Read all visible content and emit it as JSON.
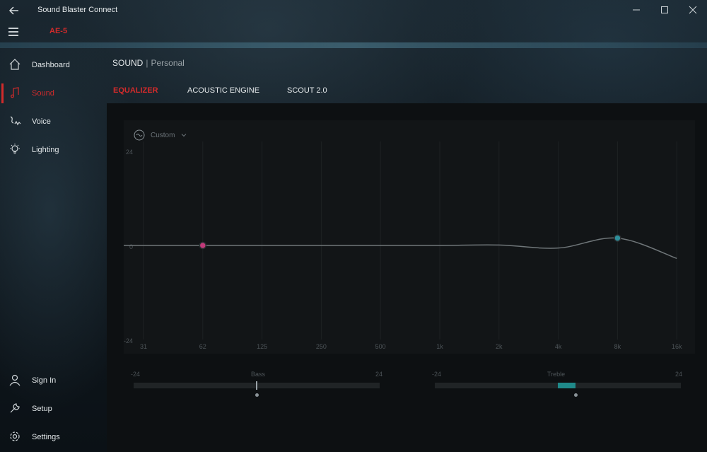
{
  "app": {
    "title": "Sound Blaster Connect",
    "device": "AE-5"
  },
  "nav": {
    "items": [
      {
        "label": "Dashboard",
        "icon": "home-icon"
      },
      {
        "label": "Sound",
        "icon": "music-note-icon",
        "active": true
      },
      {
        "label": "Voice",
        "icon": "voice-icon"
      },
      {
        "label": "Lighting",
        "icon": "lightbulb-icon"
      }
    ],
    "bottom": [
      {
        "label": "Sign In",
        "icon": "user-icon"
      },
      {
        "label": "Setup",
        "icon": "wrench-icon"
      },
      {
        "label": "Settings",
        "icon": "gear-icon"
      }
    ]
  },
  "breadcrumb": {
    "section": "SOUND",
    "separator": "|",
    "profile": "Personal"
  },
  "tabs": [
    {
      "label": "EQUALIZER",
      "active": true
    },
    {
      "label": "ACOUSTIC ENGINE"
    },
    {
      "label": "SCOUT 2.0"
    }
  ],
  "equalizer": {
    "preset": "Custom",
    "y_max_label": "24",
    "y_zero_label": "0",
    "y_min_label": "-24",
    "bands": [
      "31",
      "62",
      "125",
      "250",
      "500",
      "1k",
      "2k",
      "4k",
      "8k",
      "16k"
    ],
    "gains_db": [
      0,
      0,
      0,
      0,
      0,
      0,
      0.1,
      -0.6,
      1.7,
      -3.0
    ],
    "highlight_points": [
      {
        "band": "62",
        "gain_db": 0,
        "color": "#c13a7a"
      },
      {
        "band": "8k",
        "gain_db": 1.7,
        "color": "#2e8f9a"
      }
    ]
  },
  "bass": {
    "name": "Bass",
    "min": "-24",
    "max": "24",
    "value": 0
  },
  "treble": {
    "name": "Treble",
    "min": "-24",
    "max": "24",
    "value": 3.5
  },
  "colors": {
    "accent": "#d22b2b",
    "teal": "#1f8a8a",
    "pink": "#c13a7a"
  }
}
